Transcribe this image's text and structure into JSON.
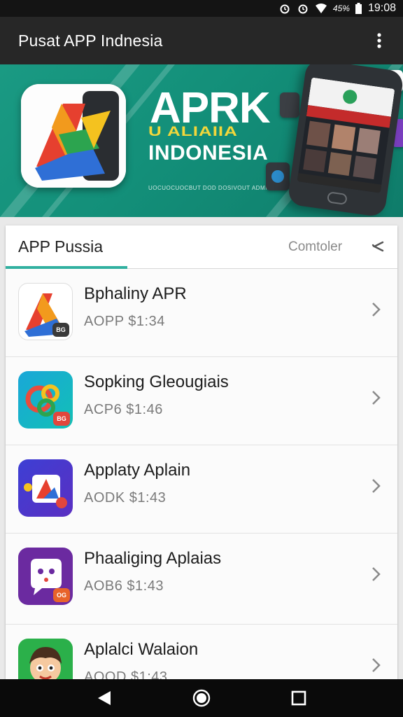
{
  "status_bar": {
    "battery": "45%",
    "time": "19:08"
  },
  "app_bar": {
    "title": "Pusat  APP Indnesia"
  },
  "banner": {
    "title": "APRK",
    "title_2": "U ALIAIIA",
    "subtitle": "INDONESIA",
    "tiny_text": "UOCUOCUOCBUT DOD DOSIVOUT ADMIN"
  },
  "tabs": {
    "active": "APP Pussia",
    "secondary": "Comtoler"
  },
  "apps": [
    {
      "name": "Bphaliny  APR",
      "price": "AOPP  $1:34",
      "badge": "BG",
      "badge_color": "#3a3a3a"
    },
    {
      "name": "Sopking Gleougiais",
      "price": "ACP6  $1:46",
      "badge": "BG",
      "badge_color": "#e2463c"
    },
    {
      "name": "Applaty Aplain",
      "price": "AODK  $1:43",
      "badge": "",
      "badge_color": "#e2463c"
    },
    {
      "name": "Phaaliging Aplaias",
      "price": "AOB6  $1:43",
      "badge": "OG",
      "badge_color": "#e8632a"
    },
    {
      "name": "Aplalci Walaion",
      "price": "AOOD  $1:43",
      "badge": "",
      "badge_color": "#2bb04a"
    }
  ],
  "colors": {
    "accent": "#31b0a0",
    "app_bar": "#272727",
    "banner": "#138f79"
  }
}
